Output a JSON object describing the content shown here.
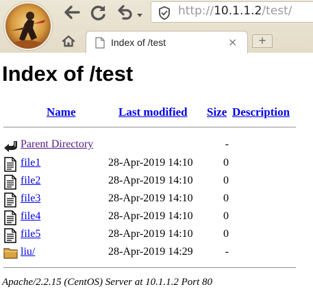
{
  "browser": {
    "url_prefix": "http://",
    "url_host": "10.1.1.2",
    "url_path": "/test/",
    "tab_title": "Index of /test",
    "tab_close": "×",
    "new_tab": "+"
  },
  "page": {
    "title": "Index of /test",
    "columns": {
      "name": "Name",
      "last_modified": "Last modified",
      "size": "Size",
      "description": "Description"
    },
    "parent": {
      "label": "Parent Directory",
      "size": "-",
      "icon": "back-arrow-icon"
    },
    "entries": [
      {
        "name": "file1",
        "modified": "28-Apr-2019 14:10",
        "size": "0",
        "icon": "text-file-icon"
      },
      {
        "name": "file2",
        "modified": "28-Apr-2019 14:10",
        "size": "0",
        "icon": "text-file-icon"
      },
      {
        "name": "file3",
        "modified": "28-Apr-2019 14:10",
        "size": "0",
        "icon": "text-file-icon"
      },
      {
        "name": "file4",
        "modified": "28-Apr-2019 14:10",
        "size": "0",
        "icon": "text-file-icon"
      },
      {
        "name": "file5",
        "modified": "28-Apr-2019 14:10",
        "size": "0",
        "icon": "text-file-icon"
      },
      {
        "name": "liu/",
        "modified": "28-Apr-2019 14:29",
        "size": "-",
        "icon": "folder-icon"
      }
    ],
    "footer": "Apache/2.2.15 (CentOS) Server at 10.1.1.2 Port 80"
  },
  "colors": {
    "link": "#0000ee",
    "visited_link": "#551a8b",
    "chrome_bg": "#e4dcc8"
  }
}
